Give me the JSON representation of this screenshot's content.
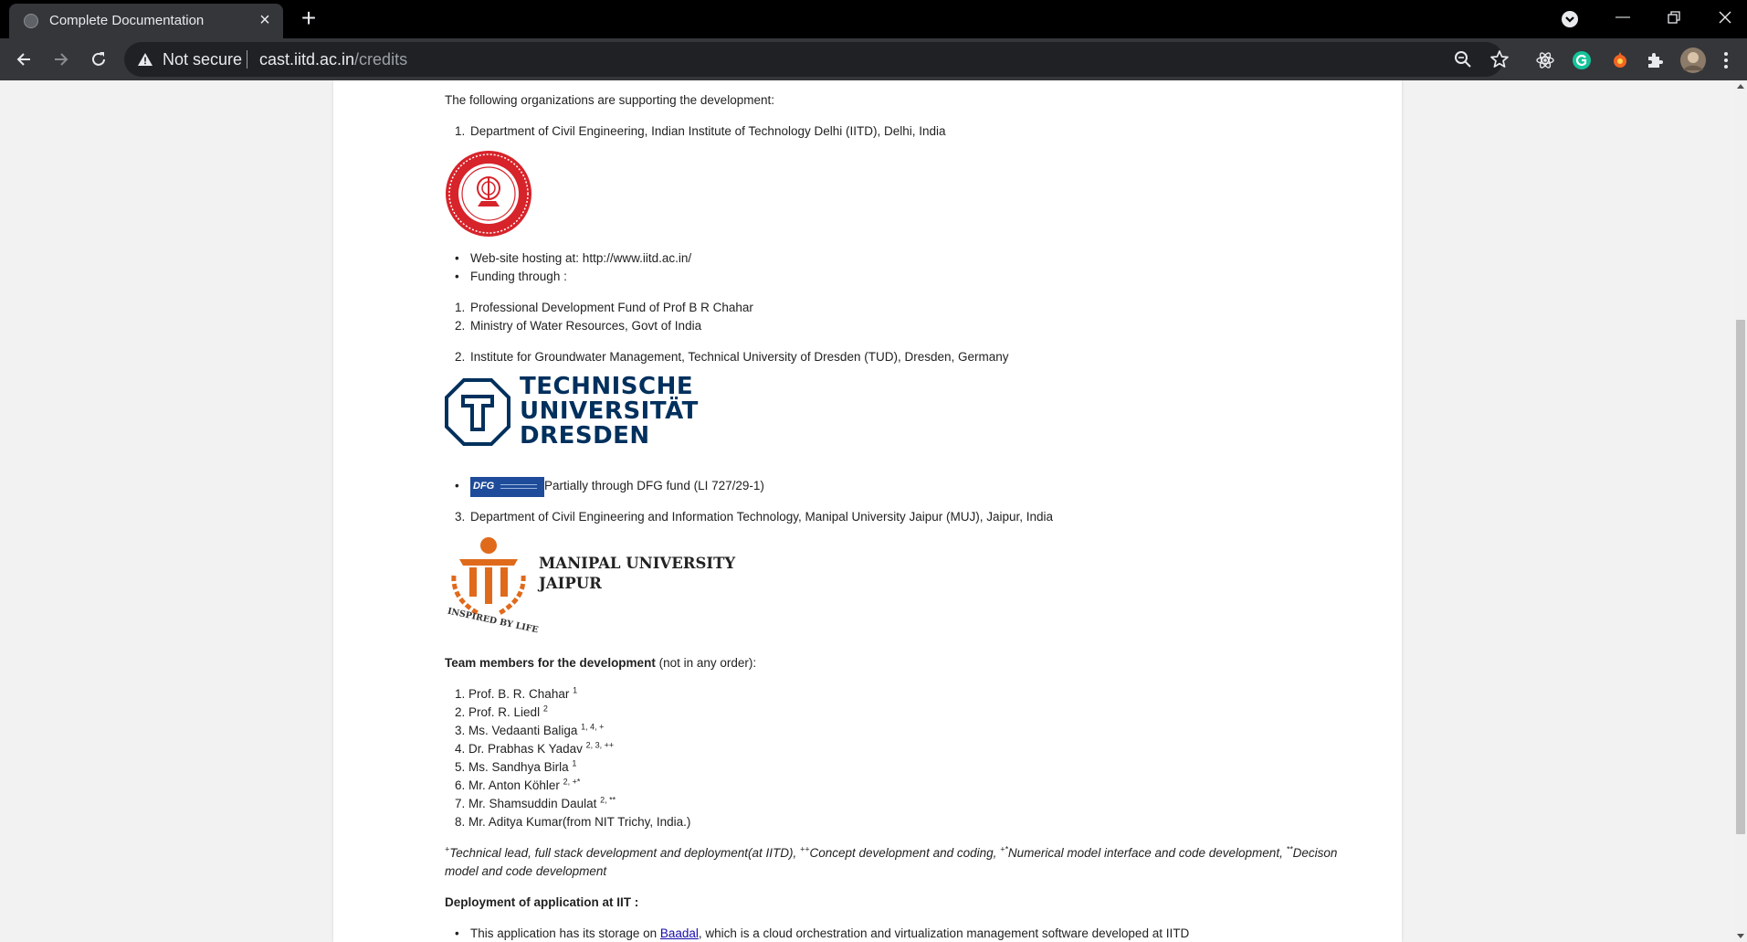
{
  "browser": {
    "tab_title": "Complete Documentation",
    "security_label": "Not secure",
    "url_host": "cast.iitd.ac.in",
    "url_path": "/credits"
  },
  "content": {
    "intro": "The following organizations are supporting the development:",
    "org1_title": "Department of Civil Engineering, Indian Institute of Technology Delhi (IITD), Delhi, India",
    "org1_bullets": [
      "Web-site hosting at: http://www.iitd.ac.in/",
      "Funding through :"
    ],
    "funding_items": [
      "Professional Development Fund of Prof B R Chahar",
      "Ministry of Water Resources, Govt of India"
    ],
    "org2_title": "Institute for Groundwater Management, Technical University of Dresden (TUD), Dresden, Germany",
    "tud_logo_lines": [
      "TECHNISCHE",
      "UNIVERSITÄT",
      "DRESDEN"
    ],
    "dfg_badge": "DFG",
    "dfg_text": "Partially through DFG fund (LI 727/29-1)",
    "org3_title": "Department of Civil Engineering and Information Technology, Manipal University Jaipur (MUJ), Jaipur, India",
    "muj_logo_lines": [
      "MANIPAL UNIVERSITY",
      "JAIPUR"
    ],
    "muj_tagline": "INSPIRED BY LIFE",
    "team_heading": "Team members for the development",
    "team_heading_note": "(not in any order):",
    "team": [
      {
        "num": "1.",
        "name": "Prof. B. R. Chahar",
        "sup": "1"
      },
      {
        "num": "2.",
        "name": "Prof. R. Liedl",
        "sup": "2"
      },
      {
        "num": "3.",
        "name": "Ms. Vedaanti Baliga",
        "sup": "1, 4, +"
      },
      {
        "num": "4.",
        "name": "Dr. Prabhas K Yadav",
        "sup": "2, 3, ++"
      },
      {
        "num": "5.",
        "name": "Ms. Sandhya Birla",
        "sup": "1"
      },
      {
        "num": "6.",
        "name": "Mr. Anton Köhler",
        "sup": "2, +*"
      },
      {
        "num": "7.",
        "name": "Mr. Shamsuddin Daulat",
        "sup": "2, **"
      },
      {
        "num": "8.",
        "name": "Mr. Aditya Kumar(from NIT Trichy, India.)",
        "sup": ""
      }
    ],
    "footnote_line1": [
      {
        "sup": "+",
        "text": "Technical lead, full stack development and deployment(at IITD), "
      },
      {
        "sup": "++",
        "text": "Concept development and coding, "
      },
      {
        "sup": "+*",
        "text": "Numerical model interface and code development, "
      },
      {
        "sup": "**",
        "text": "Decison"
      }
    ],
    "footnote_line2": "model and code development",
    "deploy_heading": "Deployment of application at IIT :",
    "deploy_text_before": "This application has its storage on ",
    "deploy_link": "Baadal",
    "deploy_text_after": ", which is a cloud orchestration and virtualization management software developed at IITD"
  },
  "colors": {
    "iitd_red": "#d7232a",
    "tud_navy": "#00305d",
    "muj_orange": "#e06a1b",
    "dfg_blue": "#1f4c9a"
  }
}
